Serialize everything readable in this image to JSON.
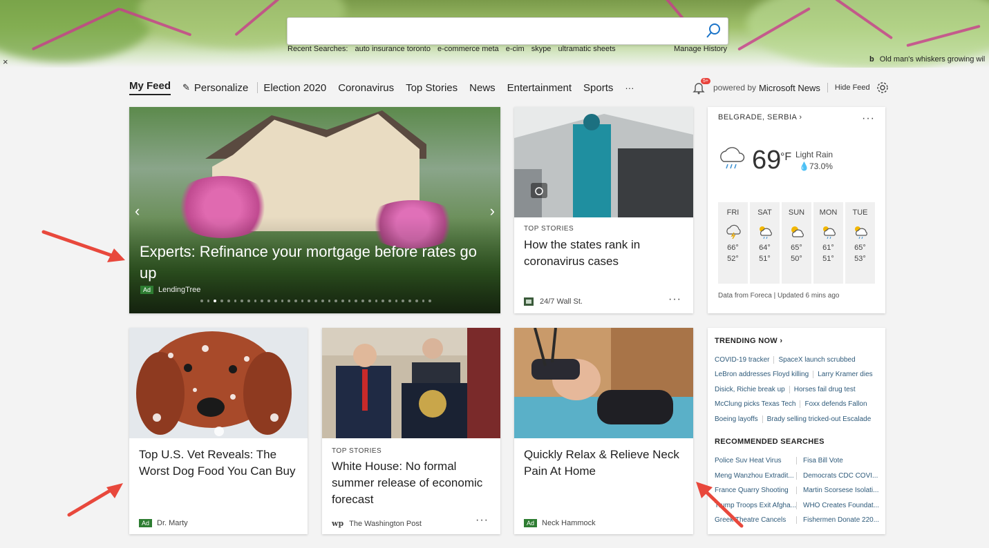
{
  "search": {
    "placeholder": "",
    "recent_label": "Recent Searches:",
    "recent": [
      "auto insurance toronto",
      "e-commerce meta",
      "e-cim",
      "skype",
      "ultramatic sheets"
    ],
    "manage_history": "Manage History"
  },
  "background": {
    "close": "×",
    "image_caption": "Old man's whiskers growing wil"
  },
  "nav": {
    "my_feed": "My Feed",
    "personalize": "Personalize",
    "items": [
      "Election 2020",
      "Coronavirus",
      "Top Stories",
      "News",
      "Entertainment",
      "Sports"
    ],
    "more": "···",
    "badge": "5+",
    "powered_prefix": "powered by",
    "powered_brand": "Microsoft News",
    "hide_feed": "Hide Feed"
  },
  "hero_card": {
    "headline": "Experts: Refinance your mortgage before rates go up",
    "ad": "Ad",
    "source": "LendingTree",
    "prev": "‹",
    "next": "›",
    "dot_count": 35,
    "active_dot": 2
  },
  "card_covid": {
    "label": "TOP STORIES",
    "title": "How the states rank in coronavirus cases",
    "source": "24/7 Wall St.",
    "more": "···"
  },
  "weather": {
    "location": "BELGRADE, SERBIA",
    "chevron": "›",
    "more": "···",
    "temp": "69",
    "unit": "°F",
    "condition": "Light Rain",
    "precip": "73.0%",
    "forecast": [
      {
        "day": "FRI",
        "hi": "66°",
        "lo": "52°",
        "icon": "thunder-cloud"
      },
      {
        "day": "SAT",
        "hi": "64°",
        "lo": "51°",
        "icon": "sun-rain"
      },
      {
        "day": "SUN",
        "hi": "65°",
        "lo": "50°",
        "icon": "sun-cloud"
      },
      {
        "day": "MON",
        "hi": "61°",
        "lo": "51°",
        "icon": "sun-rain"
      },
      {
        "day": "TUE",
        "hi": "65°",
        "lo": "53°",
        "icon": "sun-rain"
      }
    ],
    "footer": "Data from Foreca | Updated 6 mins ago"
  },
  "card_dog": {
    "title": "Top U.S. Vet Reveals: The Worst Dog Food You Can Buy",
    "ad": "Ad",
    "source": "Dr. Marty"
  },
  "card_whitehouse": {
    "label": "TOP STORIES",
    "title": "White House: No formal summer release of economic forecast",
    "source_logo": "wp",
    "source": "The Washington Post",
    "more": "···"
  },
  "card_neck": {
    "title": "Quickly Relax & Relieve Neck Pain At Home",
    "ad": "Ad",
    "source": "Neck Hammock"
  },
  "trending": {
    "title": "TRENDING NOW ›",
    "rows": [
      [
        "COVID-19 tracker",
        "SpaceX launch scrubbed"
      ],
      [
        "LeBron addresses Floyd killing",
        "Larry Kramer dies"
      ],
      [
        "Disick, Richie break up",
        "Horses fail drug test"
      ],
      [
        "McClung picks Texas Tech",
        "Foxx defends Fallon"
      ],
      [
        "Boeing layoffs",
        "Brady selling tricked-out Escalade"
      ]
    ],
    "recommended_title": "RECOMMENDED SEARCHES",
    "recommended": [
      [
        "Police Suv Heat Virus",
        "Fisa Bill Vote"
      ],
      [
        "Meng Wanzhou Extradit...",
        "Democrats CDC COVI..."
      ],
      [
        "France Quarry Shooting",
        "Martin Scorsese Isolati..."
      ],
      [
        "Trump Troops Exit Afgha...",
        "WHO Creates Foundat..."
      ],
      [
        "Greek Theatre Cancels",
        "Fishermen Donate 220..."
      ]
    ]
  },
  "colors": {
    "accent_ad": "#2e7d32",
    "badge": "#e8423b",
    "annotation_arrow": "#e8483c"
  }
}
